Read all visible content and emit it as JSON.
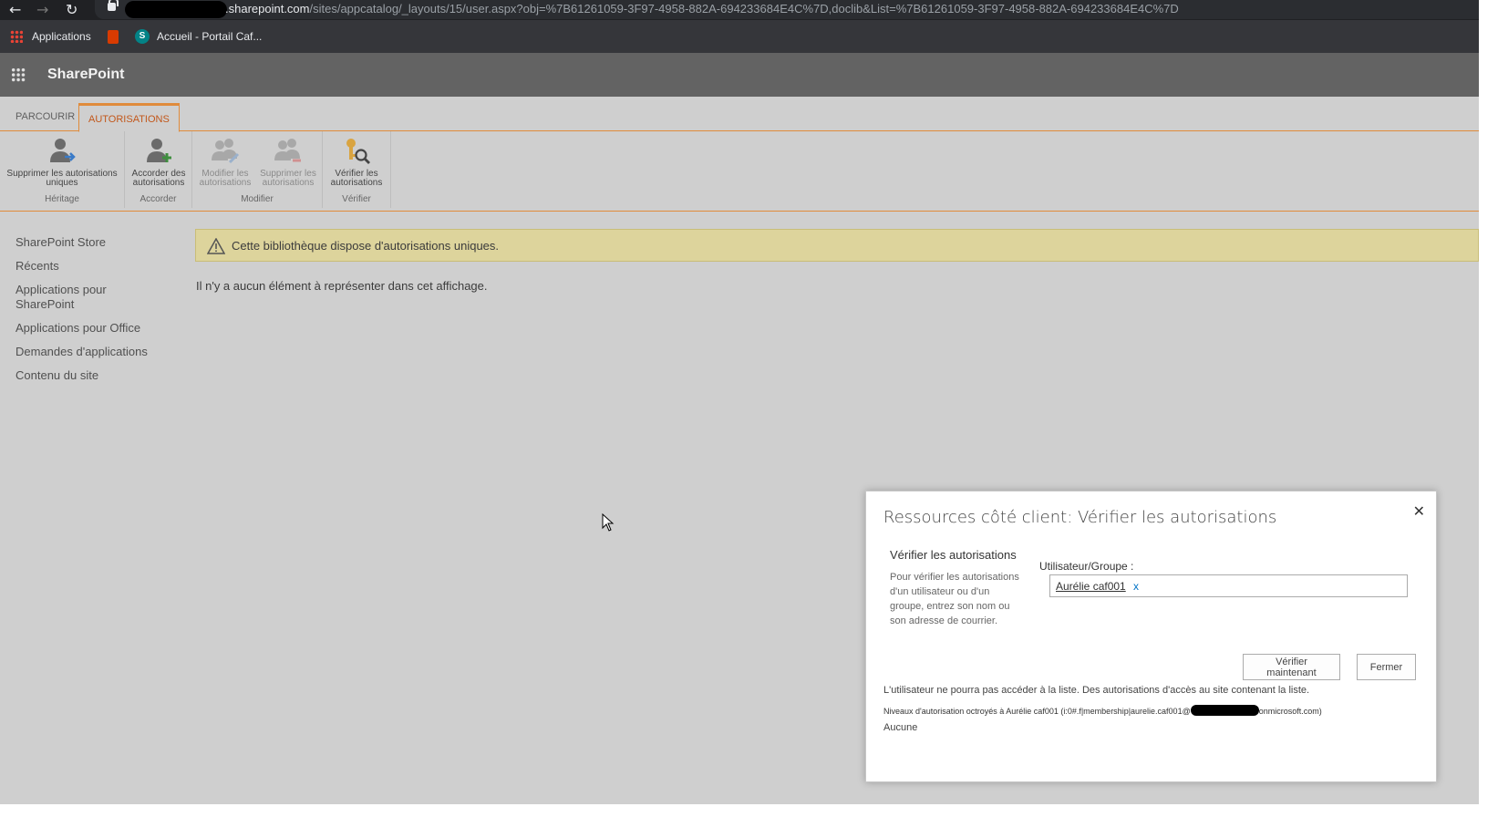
{
  "browser": {
    "url_host": ".sharepoint.com",
    "url_path": "/sites/appcatalog/_layouts/15/user.aspx?obj=%7B61261059-3F97-4958-882A-694233684E4C%7D,doclib&List=%7B61261059-3F97-4958-882A-694233684E4C%7D",
    "bookmarks": [
      "Applications",
      "Accueil - Portail Caf..."
    ]
  },
  "suite": {
    "title": "SharePoint"
  },
  "ribbon": {
    "tabs": [
      "PARCOURIR",
      "AUTORISATIONS"
    ],
    "active_tab": "AUTORISATIONS",
    "groups": [
      {
        "label": "Héritage",
        "buttons": [
          {
            "label": "Supprimer les autorisations uniques",
            "icon": "person-arrow-icon"
          }
        ]
      },
      {
        "label": "Accorder",
        "buttons": [
          {
            "label": "Accorder des autorisations",
            "icon": "person-add-icon"
          }
        ]
      },
      {
        "label": "Modifier",
        "buttons": [
          {
            "label": "Modifier les autorisations",
            "icon": "people-edit-icon"
          },
          {
            "label": "Supprimer les autorisations",
            "icon": "people-remove-icon"
          }
        ]
      },
      {
        "label": "Vérifier",
        "buttons": [
          {
            "label": "Vérifier les autorisations",
            "icon": "key-search-icon"
          }
        ]
      }
    ]
  },
  "leftnav": [
    "SharePoint Store",
    "Récents",
    "Applications pour SharePoint",
    "Applications pour Office",
    "Demandes d'applications",
    "Contenu du site"
  ],
  "content": {
    "banner": "Cette bibliothèque dispose d'autorisations uniques.",
    "empty": "Il n'y a aucun élément à représenter dans cet affichage."
  },
  "dialog": {
    "title": "Ressources côté client: Vérifier les autorisations",
    "section_title": "Vérifier les autorisations",
    "section_desc": "Pour vérifier les autorisations d'un utilisateur ou d'un groupe, entrez son nom ou son adresse de courrier.",
    "field_label": "Utilisateur/Groupe :",
    "picker_user": "Aurélie caf001",
    "picker_remove": "x",
    "check_button": "Vérifier maintenant",
    "close_button": "Fermer",
    "result_line1": "L'utilisateur ne pourra pas accéder à la liste. Des autorisations d'accès au site contenant la liste.",
    "result_line2_prefix": "Niveaux d'autorisation octroyés à Aurélie caf001 (i:0#.f|membership|aurelie.caf001@",
    "result_line2_suffix": "onmicrosoft.com)",
    "result_none": "Aucune",
    "close_glyph": "✕"
  },
  "colors": {
    "accent": "#e08b3b",
    "suite_bar": "#636363",
    "banner": "#ddd49c"
  }
}
